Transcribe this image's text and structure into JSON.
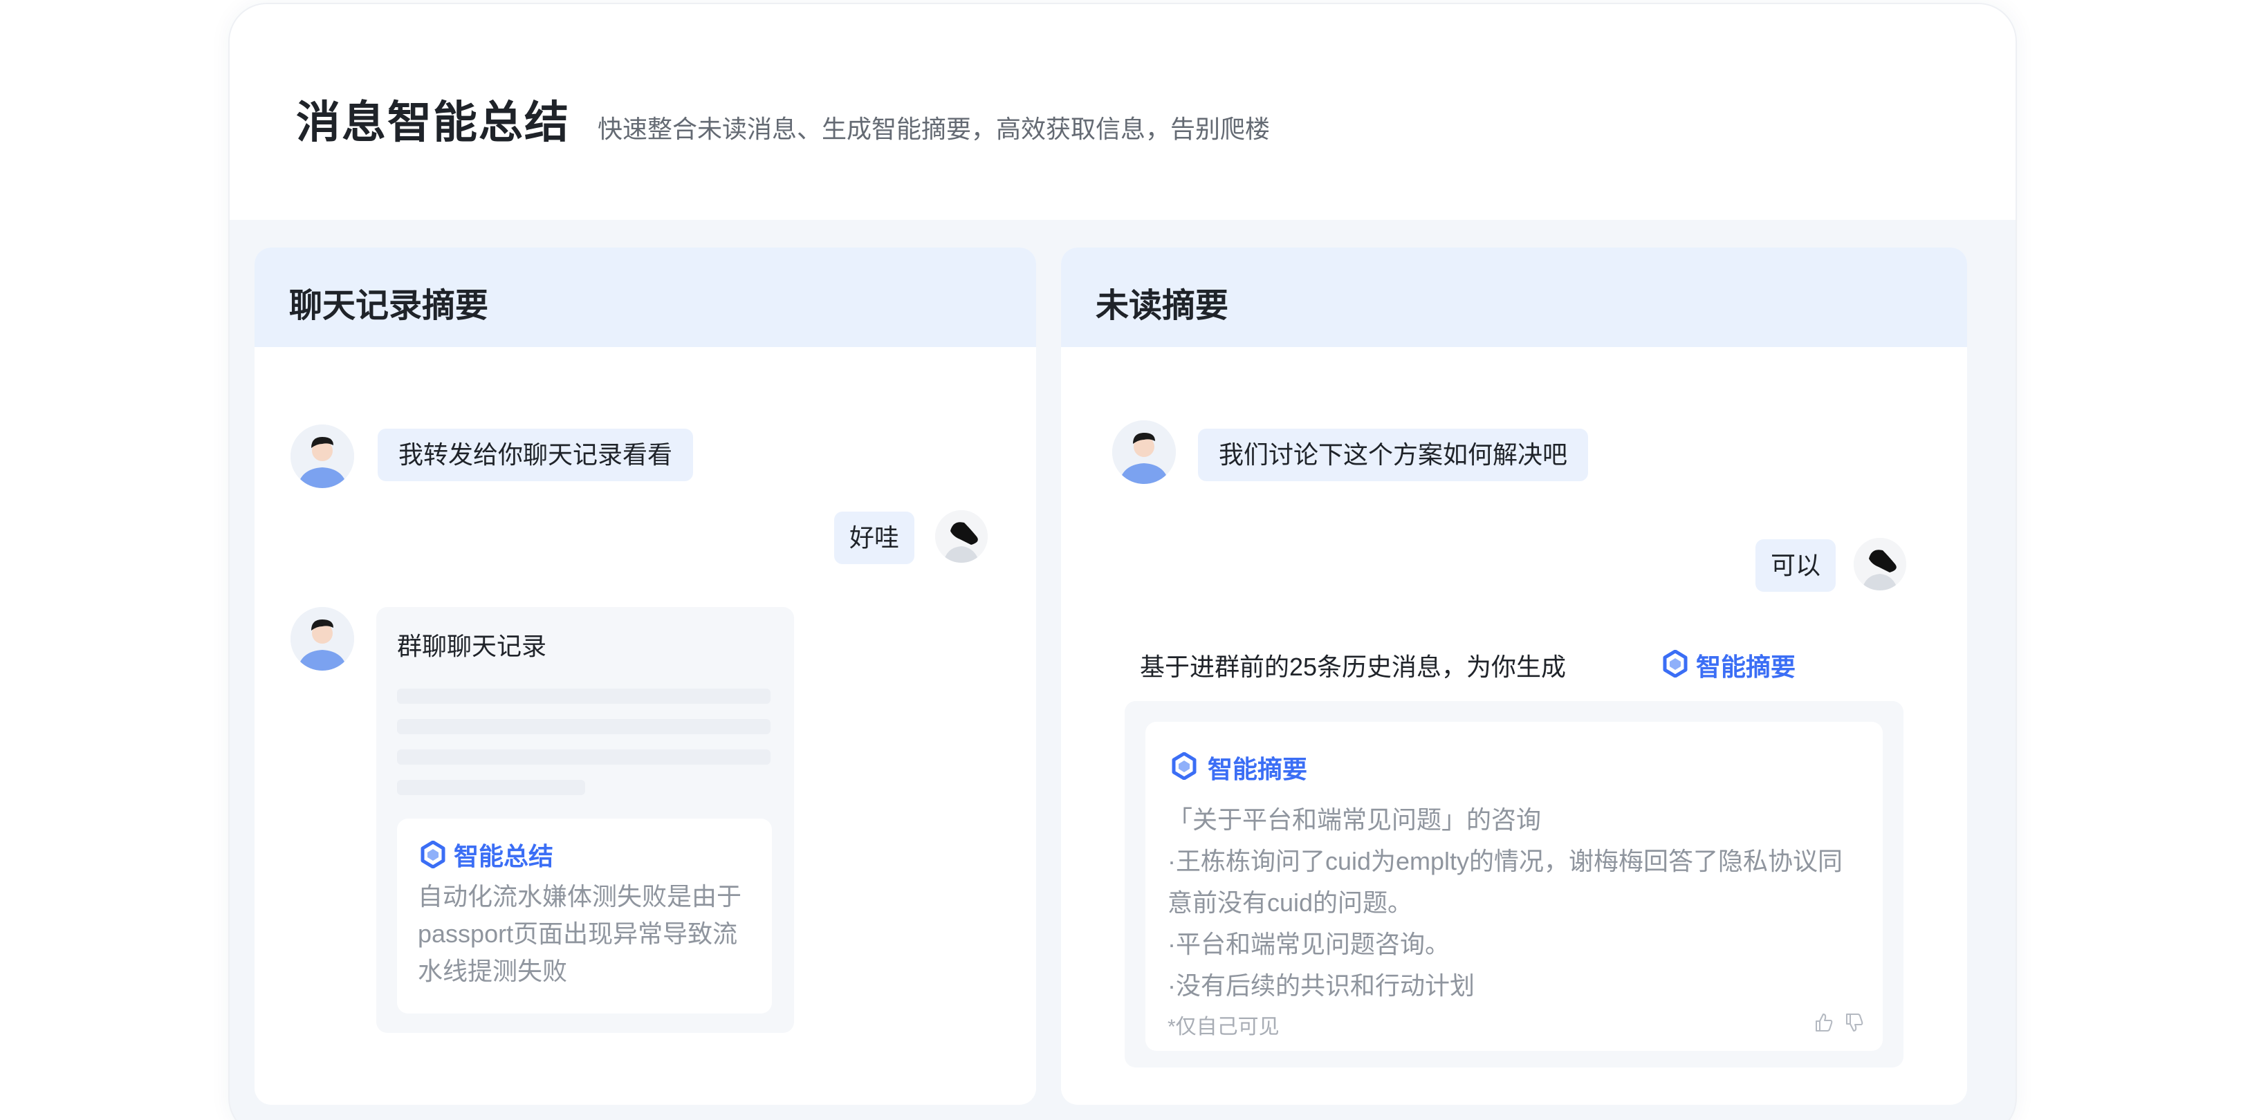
{
  "header": {
    "title": "消息智能总结",
    "subtitle": "快速整合未读消息、生成智能摘要，高效获取信息，告别爬楼"
  },
  "left_panel": {
    "title": "聊天记录摘要",
    "messages": [
      {
        "from": "other",
        "text": "我转发给你聊天记录看看"
      },
      {
        "from": "self",
        "text": "好哇"
      }
    ],
    "record_card": {
      "title": "群聊聊天记录",
      "ai_label": "智能总结",
      "ai_text": "自动化流水嫌体测失败是由于passport页面出现异常导致流水线提测失败"
    }
  },
  "right_panel": {
    "title": "未读摘要",
    "messages": [
      {
        "from": "other",
        "text": "我们讨论下这个方案如何解决吧"
      },
      {
        "from": "self",
        "text": "可以"
      }
    ],
    "context_text": "基于进群前的25条历史消息，为你生成",
    "context_ai_label": "智能摘要",
    "summary_card": {
      "ai_label": "智能摘要",
      "lines": [
        "「关于平台和端常见问题」的咨询",
        "·王栋栋询问了cuid为emplty的情况，谢梅梅回答了隐私协议同意前没有cuid的问题。",
        "·平台和端常见问题咨询。",
        "·没有后续的共识和行动计划"
      ],
      "note": "*仅自己可见"
    }
  },
  "colors": {
    "accent": "#3b6ef5",
    "panel_header": "#e9f1fd",
    "bubble": "#eaf1fd",
    "muted_text": "#8f959e"
  },
  "icons": [
    "user-avatar-icon",
    "self-avatar-icon",
    "ai-hexagon-icon",
    "thumbs-up-icon",
    "thumbs-down-icon"
  ]
}
